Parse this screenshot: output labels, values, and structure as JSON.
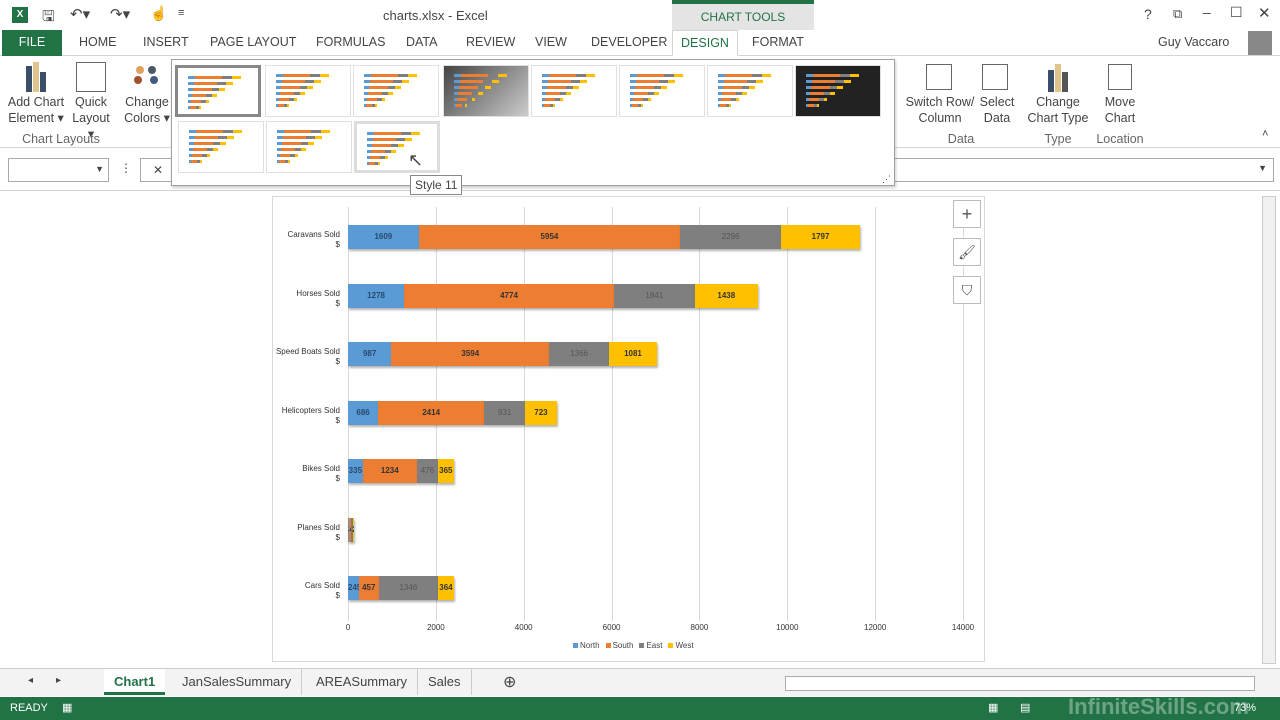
{
  "window": {
    "title": "charts.xlsx - Excel",
    "context_tab": "CHART TOOLS",
    "user": "Guy Vaccaro"
  },
  "tabs": [
    "FILE",
    "HOME",
    "INSERT",
    "PAGE LAYOUT",
    "FORMULAS",
    "DATA",
    "REVIEW",
    "VIEW",
    "DEVELOPER",
    "DESIGN",
    "FORMAT"
  ],
  "active_tab": "DESIGN",
  "ribbon": {
    "add_chart_element": [
      "Add Chart",
      "Element ▾"
    ],
    "quick_layout": [
      "Quick",
      "Layout ▾"
    ],
    "change_colors": [
      "Change",
      "Colors ▾"
    ],
    "chart_layouts_group": "Chart Layouts",
    "switch_row_column": [
      "Switch Row/",
      "Column"
    ],
    "select_data": [
      "Select",
      "Data"
    ],
    "data_group": "Data",
    "change_chart_type": [
      "Change",
      "Chart Type"
    ],
    "type_group": "Type",
    "move_chart": [
      "Move",
      "Chart"
    ],
    "location_group": "Location"
  },
  "gallery": {
    "styles": 12,
    "selected_style": 1,
    "hovered_style": 11,
    "tooltip": "Style 11"
  },
  "sheets": {
    "tabs": [
      "Chart1",
      "JanSalesSummary",
      "AREASummary",
      "Sales"
    ],
    "active": "Chart1"
  },
  "status": {
    "ready": "READY",
    "zoom": "73%",
    "watermark": "InfiniteSkills.com"
  },
  "colors": {
    "north": "#5b9bd5",
    "south": "#ed7d31",
    "east": "#7f7f7f",
    "west": "#ffc000",
    "excel_green": "#217346"
  },
  "chart_data": {
    "type": "bar",
    "orientation": "horizontal",
    "stacked": true,
    "categories": [
      "Caravans Sold $",
      "Horses Sold $",
      "Speed Boats Sold $",
      "Helicopters Sold $",
      "Bikes Sold $",
      "Planes Sold $",
      "Cars Sold $"
    ],
    "series": [
      {
        "name": "North",
        "values": [
          1609,
          1278,
          987,
          686,
          335,
          32,
          245
        ]
      },
      {
        "name": "South",
        "values": [
          5954,
          4774,
          3594,
          2414,
          1234,
          41,
          457
        ]
      },
      {
        "name": "East",
        "values": [
          2296,
          1841,
          1366,
          931,
          476,
          30,
          1346
        ]
      },
      {
        "name": "West",
        "values": [
          1797,
          1438,
          1081,
          723,
          365,
          20,
          364
        ]
      }
    ],
    "xlim": [
      0,
      14000
    ],
    "xticks": [
      "0",
      "2000",
      "4000",
      "6000",
      "8000",
      "10000",
      "12000",
      "14000"
    ],
    "grid": true,
    "legend": "bottom",
    "data_labels": true
  }
}
